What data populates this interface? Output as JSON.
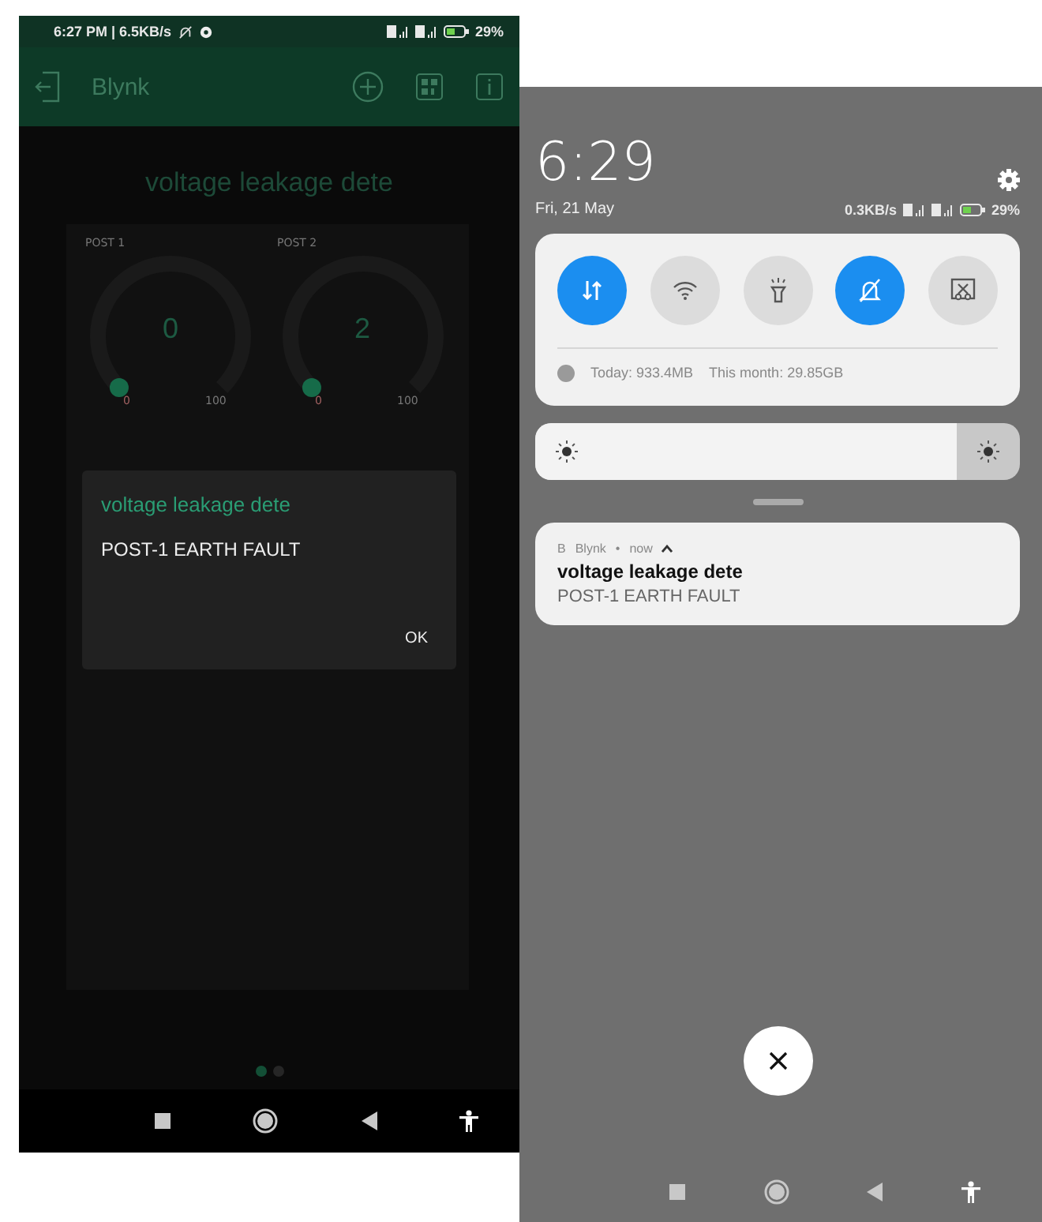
{
  "blynk_screen": {
    "status_bar": {
      "time": "6:27 PM | 6.5KB/s",
      "battery": "29%"
    },
    "app_bar": {
      "title": "Blynk"
    },
    "project_title": "voltage leakage dete",
    "gauges": [
      {
        "label": "POST 1",
        "value": "0",
        "min": "0",
        "max": "100"
      },
      {
        "label": "POST 2",
        "value": "2",
        "min": "0",
        "max": "100"
      }
    ],
    "dialog": {
      "title": "voltage leakage dete",
      "message": "POST-1 EARTH FAULT",
      "button": "OK"
    },
    "page_dots": [
      {
        "selected": true
      },
      {
        "selected": false
      }
    ]
  },
  "notification_shade": {
    "clock": "6:29",
    "date": "Fri, 21 May",
    "net_speed": "0.3KB/s",
    "battery": "29%",
    "toggles": [
      {
        "kind": "data",
        "on": true
      },
      {
        "kind": "wifi",
        "on": false
      },
      {
        "kind": "flashlight",
        "on": false
      },
      {
        "kind": "silent",
        "on": true
      },
      {
        "kind": "screenshot",
        "on": false
      }
    ],
    "data_usage": {
      "today": "Today: 933.4MB",
      "month": "This month: 29.85GB"
    },
    "brightness": {
      "level": 0.87
    },
    "notification": {
      "app_letter": "B",
      "app": "Blynk",
      "separator": "•",
      "time": "now",
      "title": "voltage leakage dete",
      "text": "POST-1 EARTH FAULT"
    }
  }
}
